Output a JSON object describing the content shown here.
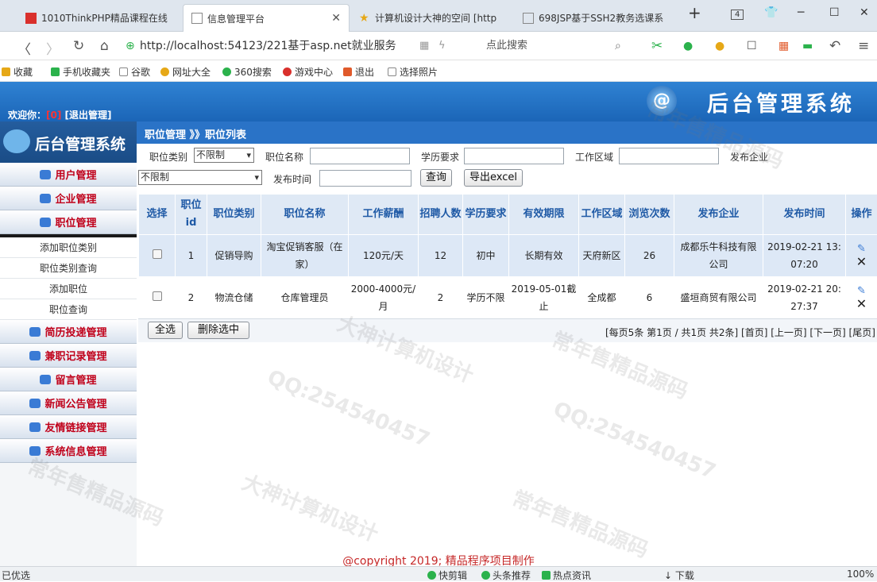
{
  "browser": {
    "tabs": [
      {
        "label": "1010ThinkPHP精品课程在线",
        "icon_color": "#d9302c"
      },
      {
        "label": "信息管理平台",
        "icon_color": "#888888"
      },
      {
        "label": "计算机设计大神的空间 [http",
        "icon_color": "#e6a817"
      },
      {
        "label": "698JSP基于SSH2教务选课系",
        "icon_color": "#888888"
      }
    ],
    "new_tab": "+",
    "tab_count": "4",
    "address": "http://localhost:54123/221基于asp.net就业服务",
    "search_placeholder": "点此搜索",
    "bookmarks": [
      "收藏",
      "手机收藏夹",
      "谷歌",
      "网址大全",
      "360搜索",
      "游戏中心",
      "退出",
      "选择照片"
    ]
  },
  "header": {
    "welcome_label": "欢迎你：",
    "user": "[0]",
    "logout": "[退出管理]",
    "title": "后台管理系统",
    "logo_glyph": "@"
  },
  "sidebar": {
    "title": "后台管理系统",
    "menus": [
      {
        "label": "用户管理"
      },
      {
        "label": "企业管理"
      },
      {
        "label": "职位管理",
        "subs": [
          "添加职位类别",
          "职位类别查询",
          "添加职位",
          "职位查询"
        ]
      },
      {
        "label": "简历投递管理"
      },
      {
        "label": "兼职记录管理"
      },
      {
        "label": "留言管理"
      },
      {
        "label": "新闻公告管理"
      },
      {
        "label": "友情链接管理"
      },
      {
        "label": "系统信息管理"
      }
    ]
  },
  "main": {
    "breadcrumb": "职位管理 》》职位列表",
    "filters": {
      "category_label": "职位类别",
      "category_value": "不限制",
      "name_label": "职位名称",
      "edu_label": "学历要求",
      "area_label": "工作区域",
      "company_label": "发布企业",
      "company_value": "不限制",
      "time_label": "发布时间",
      "query_btn": "查询",
      "export_btn": "导出excel"
    },
    "columns": [
      "选择",
      "职位id",
      "职位类别",
      "职位名称",
      "工作薪酬",
      "招聘人数",
      "学历要求",
      "有效期限",
      "工作区域",
      "浏览次数",
      "发布企业",
      "发布时间",
      "操作"
    ],
    "rows": [
      {
        "id": "1",
        "category": "促销导购",
        "name": "淘宝促销客服（在家）",
        "salary": "120元/天",
        "count": "12",
        "edu": "初中",
        "validity": "长期有效",
        "area": "天府新区",
        "views": "26",
        "company": "成都乐牛科技有限公司",
        "time": "2019-02-21 13:07:20"
      },
      {
        "id": "2",
        "category": "物流仓储",
        "name": "仓库管理员",
        "salary": "2000-4000元/月",
        "count": "2",
        "edu": "学历不限",
        "validity": "2019-05-01截止",
        "area": "全成都",
        "views": "6",
        "company": "盛垣商贸有限公司",
        "time": "2019-02-21 20:27:37"
      }
    ],
    "select_all": "全选",
    "delete_selected": "删除选中",
    "pagination": "[每页5条 第1页 / 共1页 共2条]  [首页]  [上一页]  [下一页]  [尾页]"
  },
  "footer": "@copyright 2019; 精品程序项目制作",
  "statusbar": {
    "left": "已优选",
    "items": [
      "快剪辑",
      "头条推荐",
      "热点资讯",
      "下载"
    ],
    "zoom": "100%"
  },
  "watermarks": [
    "QQ:254540457",
    "常年售精品源码",
    "大神计算机设计"
  ]
}
